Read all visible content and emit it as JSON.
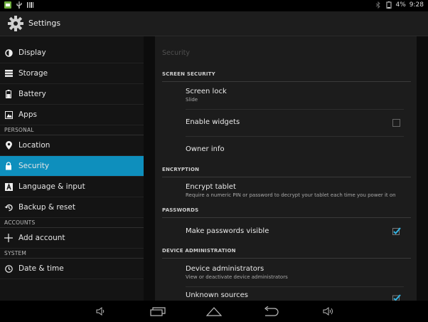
{
  "status_bar": {
    "left_icons": [
      "app-notification-icon",
      "usb-icon",
      "barcode-icon"
    ],
    "right_icons": [
      "bluetooth-icon",
      "battery-icon"
    ],
    "battery_text": "4%",
    "time": "9:28"
  },
  "action_bar": {
    "title": "Settings",
    "icon": "gear-icon"
  },
  "sidebar": {
    "items_device": [
      {
        "label": "Display",
        "icon": "brightness-icon"
      },
      {
        "label": "Storage",
        "icon": "storage-icon"
      },
      {
        "label": "Battery",
        "icon": "battery-icon"
      },
      {
        "label": "Apps",
        "icon": "apps-icon"
      }
    ],
    "personal_header": "PERSONAL",
    "items_personal": [
      {
        "label": "Location",
        "icon": "location-pin-icon"
      },
      {
        "label": "Security",
        "icon": "lock-icon",
        "selected": true
      },
      {
        "label": "Language & input",
        "icon": "keyboard-icon"
      },
      {
        "label": "Backup & reset",
        "icon": "restore-icon"
      }
    ],
    "accounts_header": "ACCOUNTS",
    "items_accounts": [
      {
        "label": "Add account",
        "icon": "plus-icon"
      }
    ],
    "system_header": "SYSTEM",
    "items_system": [
      {
        "label": "Date & time",
        "icon": "clock-icon"
      }
    ]
  },
  "panel": {
    "subtitle": "Security",
    "screen_security_header": "SCREEN SECURITY",
    "screen_lock": {
      "title": "Screen lock",
      "summary": "Slide"
    },
    "enable_widgets": {
      "title": "Enable widgets",
      "checked": false
    },
    "owner_info": {
      "title": "Owner info"
    },
    "encryption_header": "ENCRYPTION",
    "encrypt_tablet": {
      "title": "Encrypt tablet",
      "summary": "Require a numeric PIN or password to decrypt your tablet each time you power it on"
    },
    "passwords_header": "PASSWORDS",
    "passwords_visible": {
      "title": "Make passwords visible",
      "checked": true
    },
    "device_admin_header": "DEVICE ADMINISTRATION",
    "device_admins": {
      "title": "Device administrators",
      "summary": "View or deactivate device administrators"
    },
    "unknown_sources": {
      "title": "Unknown sources",
      "checked": true
    }
  },
  "nav_bar": {
    "buttons": [
      "volume-down-icon",
      "recent-apps-icon",
      "home-icon",
      "back-icon",
      "volume-up-icon"
    ]
  }
}
